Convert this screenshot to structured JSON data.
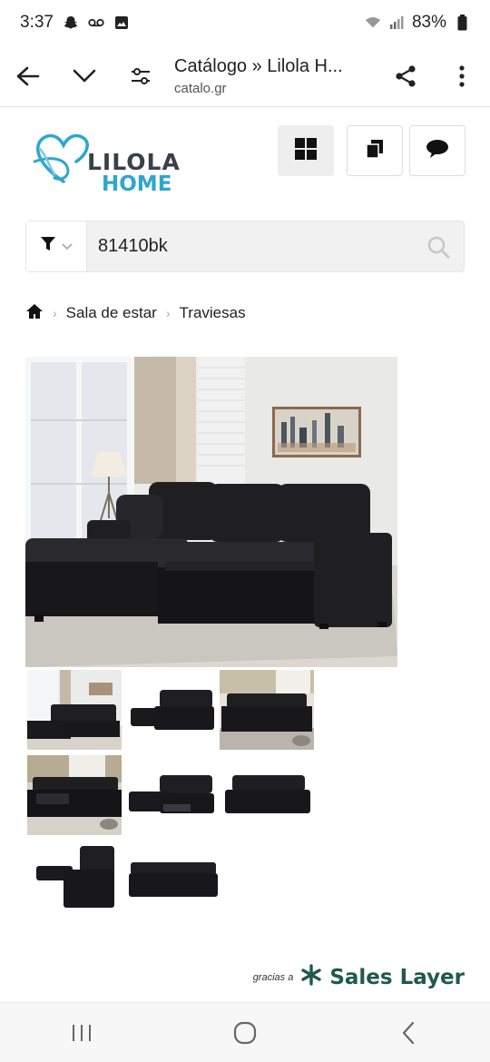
{
  "status_bar": {
    "time": "3:37",
    "battery": "83%",
    "icons": [
      "snapchat-icon",
      "voicemail-icon",
      "gallery-icon",
      "wifi-icon",
      "signal-icon",
      "battery-icon"
    ]
  },
  "browser": {
    "title": "Catálogo » Lilola H...",
    "url": "catalo.gr",
    "icons": [
      "back-arrow-icon",
      "chevron-down-icon",
      "page-settings-icon",
      "share-icon",
      "more-vert-icon"
    ]
  },
  "header": {
    "logo_line1": "LILOLA",
    "logo_line2": "HOME",
    "view_buttons": [
      "grid-view-icon",
      "copy-icon",
      "chat-icon"
    ]
  },
  "search": {
    "query": "81410bk",
    "icons": [
      "filter-icon",
      "chevron-down-icon",
      "search-icon"
    ]
  },
  "breadcrumb": {
    "home_icon": "home-icon",
    "items": [
      "Sala de estar",
      "Traviesas"
    ]
  },
  "gallery": {
    "thumbnail_count": 8
  },
  "footer": {
    "credit_prefix": "gracias a",
    "credit_brand": "Sales Layer"
  },
  "colors": {
    "sofa": "#1f1f22",
    "logo_blue": "#2ea6cf",
    "logo_gray": "#39404a",
    "brand_green": "#1f5a4a"
  },
  "navbar": {
    "icons": [
      "recent-apps-icon",
      "home-circle-icon",
      "back-chevron-icon"
    ]
  }
}
